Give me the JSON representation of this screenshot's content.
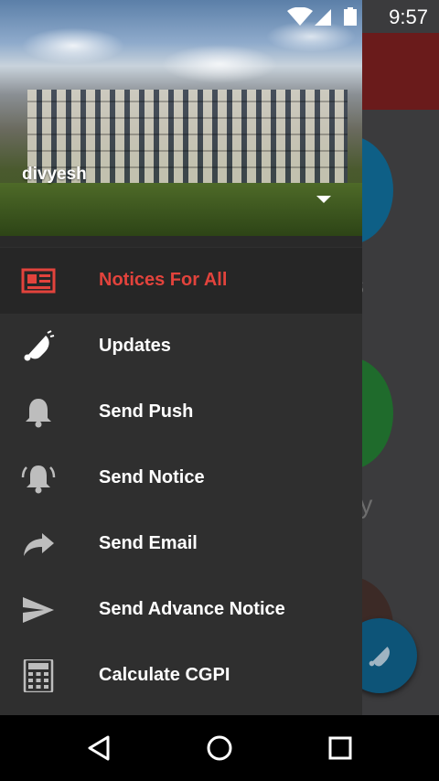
{
  "status_bar": {
    "time": "9:57"
  },
  "background_app": {
    "labels": [
      "s",
      "ry"
    ]
  },
  "drawer": {
    "user_name": "divyesh",
    "menu": [
      {
        "label": "Notices For All",
        "icon": "newspaper-icon",
        "active": true
      },
      {
        "label": "Updates",
        "icon": "bell-ringing-icon",
        "active": false
      },
      {
        "label": "Send Push",
        "icon": "bell-icon",
        "active": false
      },
      {
        "label": "Send Notice",
        "icon": "bell-alert-icon",
        "active": false
      },
      {
        "label": "Send Email",
        "icon": "share-arrow-icon",
        "active": false
      },
      {
        "label": "Send Advance Notice",
        "icon": "send-icon",
        "active": false
      },
      {
        "label": "Calculate CGPI",
        "icon": "calculator-icon",
        "active": false
      }
    ]
  },
  "colors": {
    "active": "#e2433c",
    "drawer": "#2f2f2f",
    "header_app": "#6a1b1b"
  }
}
